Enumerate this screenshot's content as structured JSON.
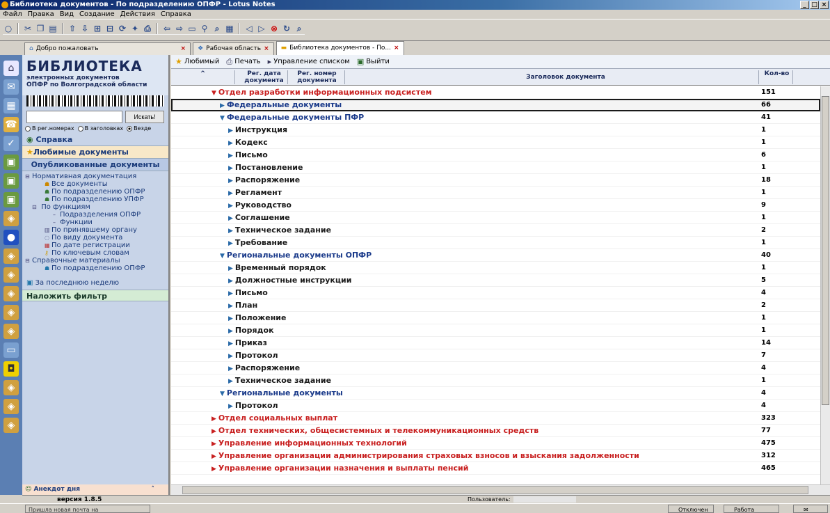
{
  "window": {
    "title": "Библиотека документов - По подразделению ОПФР - Lotus Notes"
  },
  "menu": [
    "Файл",
    "Правка",
    "Вид",
    "Создание",
    "Действия",
    "Справка"
  ],
  "tabs": [
    {
      "label": "Добро пожаловать",
      "active": false
    },
    {
      "label": "Рабочая область",
      "active": false
    },
    {
      "label": "Библиотека документов - По...",
      "active": true
    }
  ],
  "nav": {
    "brand_title": "БИБЛИОТЕКА",
    "brand_sub1": "электронных документов",
    "brand_sub2": "ОПФР по Волгоградской области",
    "search_button": "Искать!",
    "search_value": "",
    "radios": [
      {
        "label": "В рег.номерах",
        "checked": false
      },
      {
        "label": "В заголовках",
        "checked": false
      },
      {
        "label": "Везде",
        "checked": true
      }
    ],
    "help": "Справка",
    "favorites": "Любимые документы",
    "published": "Опубликованные документы",
    "tree": [
      "Нормативная документация",
      "Все документы",
      "По подразделению ОПФР",
      "По подразделению УПФР",
      "По функциям",
      "Подразделения ОПФР",
      "Функции",
      "По принявшему органу",
      "По виду документа",
      "По дате регистрации",
      "По ключевым словам",
      "Справочные материалы",
      "По подразделению ОПФР"
    ],
    "last_week": "За последнюю неделю",
    "filter": "Наложить фильтр",
    "anekdot": "Анекдот дня",
    "version": "версия 1.8.5"
  },
  "actions": [
    "Любимый",
    "Печать",
    "Управление списком",
    "Выйти"
  ],
  "columns": {
    "reg_date": "Рег. дата документа",
    "reg_num": "Рег. номер документа",
    "title": "Заголовок документа",
    "count": "Кол-во"
  },
  "rows": [
    {
      "level": 0,
      "expanded": true,
      "label": "Отдел разработки информационных подсистем",
      "count": "151"
    },
    {
      "level": 1,
      "expanded": false,
      "label": "Федеральные документы",
      "count": "66",
      "selected": true
    },
    {
      "level": 1,
      "expanded": true,
      "label": "Федеральные документы ПФР",
      "count": "41"
    },
    {
      "level": 2,
      "expanded": false,
      "label": "Инструкция",
      "count": "1"
    },
    {
      "level": 2,
      "expanded": false,
      "label": "Кодекс",
      "count": "1"
    },
    {
      "level": 2,
      "expanded": false,
      "label": "Письмо",
      "count": "6"
    },
    {
      "level": 2,
      "expanded": false,
      "label": "Постановление",
      "count": "1"
    },
    {
      "level": 2,
      "expanded": false,
      "label": "Распоряжение",
      "count": "18"
    },
    {
      "level": 2,
      "expanded": false,
      "label": "Регламент",
      "count": "1"
    },
    {
      "level": 2,
      "expanded": false,
      "label": "Руководство",
      "count": "9"
    },
    {
      "level": 2,
      "expanded": false,
      "label": "Соглашение",
      "count": "1"
    },
    {
      "level": 2,
      "expanded": false,
      "label": "Техническое задание",
      "count": "2"
    },
    {
      "level": 2,
      "expanded": false,
      "label": "Требование",
      "count": "1"
    },
    {
      "level": 1,
      "expanded": true,
      "label": "Региональные документы ОПФР",
      "count": "40"
    },
    {
      "level": 2,
      "expanded": false,
      "label": "Временный порядок",
      "count": "1"
    },
    {
      "level": 2,
      "expanded": false,
      "label": "Должностные инструкции",
      "count": "5"
    },
    {
      "level": 2,
      "expanded": false,
      "label": "Письмо",
      "count": "4"
    },
    {
      "level": 2,
      "expanded": false,
      "label": "План",
      "count": "2"
    },
    {
      "level": 2,
      "expanded": false,
      "label": "Положение",
      "count": "1"
    },
    {
      "level": 2,
      "expanded": false,
      "label": "Порядок",
      "count": "1"
    },
    {
      "level": 2,
      "expanded": false,
      "label": "Приказ",
      "count": "14"
    },
    {
      "level": 2,
      "expanded": false,
      "label": "Протокол",
      "count": "7"
    },
    {
      "level": 2,
      "expanded": false,
      "label": "Распоряжение",
      "count": "4"
    },
    {
      "level": 2,
      "expanded": false,
      "label": "Техническое задание",
      "count": "1"
    },
    {
      "level": 1,
      "expanded": true,
      "label": "Региональные документы",
      "count": "4"
    },
    {
      "level": 2,
      "expanded": false,
      "label": "Протокол",
      "count": "4"
    },
    {
      "level": 0,
      "expanded": false,
      "label": "Отдел социальных выплат",
      "count": "323"
    },
    {
      "level": 0,
      "expanded": false,
      "label": "Отдел технических, общесистемных и телекоммуникационных средств",
      "count": "77"
    },
    {
      "level": 0,
      "expanded": false,
      "label": "Управление информационных технологий",
      "count": "475"
    },
    {
      "level": 0,
      "expanded": false,
      "label": "Управление организации администрирования страховых взносов и взыскания задолженности",
      "count": "312"
    },
    {
      "level": 0,
      "expanded": false,
      "label": "Управление организации назначения и выплаты пенсий",
      "count": "465"
    }
  ],
  "footer": {
    "user_label": "Пользователь:",
    "status_message": "Пришла новая почта на",
    "status_offline": "Отключен",
    "status_work": "Работа"
  }
}
